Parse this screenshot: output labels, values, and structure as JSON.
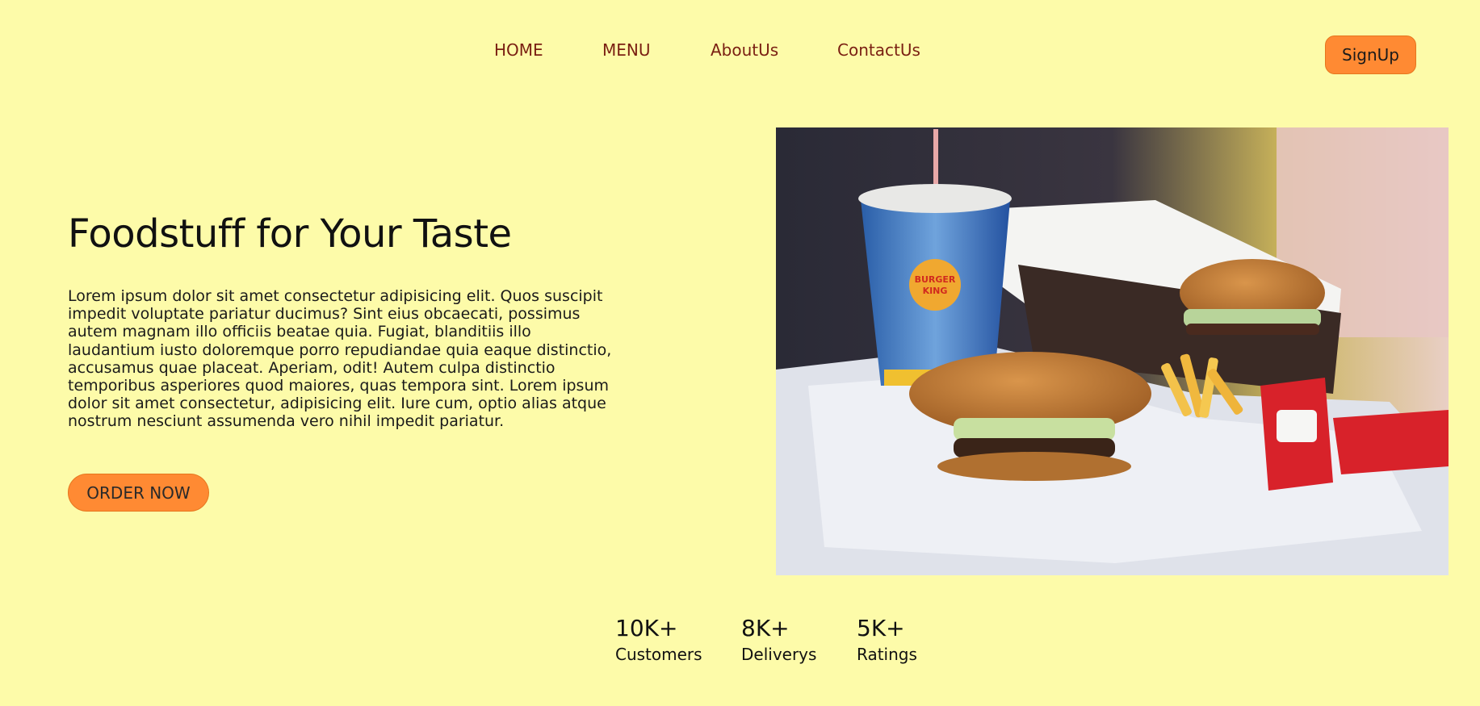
{
  "nav": {
    "links": [
      {
        "label": "HOME"
      },
      {
        "label": "MENU"
      },
      {
        "label": "AboutUs"
      },
      {
        "label": "ContactUs"
      }
    ],
    "signup_label": "SignUp"
  },
  "hero": {
    "title": "Foodstuff for Your Taste",
    "text": "Lorem ipsum dolor sit amet consectetur adipisicing elit. Quos suscipit impedit voluptate pariatur ducimus? Sint eius obcaecati, possimus autem magnam illo officiis beatae quia. Fugiat, blanditiis illo laudantium iusto doloremque porro repudiandae quia eaque distinctio, accusamus quae placeat. Aperiam, odit! Autem culpa distinctio temporibus asperiores quod maiores, quas tempora sint. Lorem ipsum dolor sit amet consectetur, adipisicing elit. Iure cum, optio alias atque nostrum nesciunt assumenda vero nihil impedit pariatur.",
    "order_label": "ORDER NOW",
    "image_brand": "BURGER KING"
  },
  "stats": [
    {
      "value": "10K+",
      "label": "Customers"
    },
    {
      "value": "8K+",
      "label": "Deliverys"
    },
    {
      "value": "5K+",
      "label": "Ratings"
    }
  ],
  "colors": {
    "background": "#fdfba9",
    "accent": "#ff8a33",
    "nav_text": "#7a1f12"
  }
}
